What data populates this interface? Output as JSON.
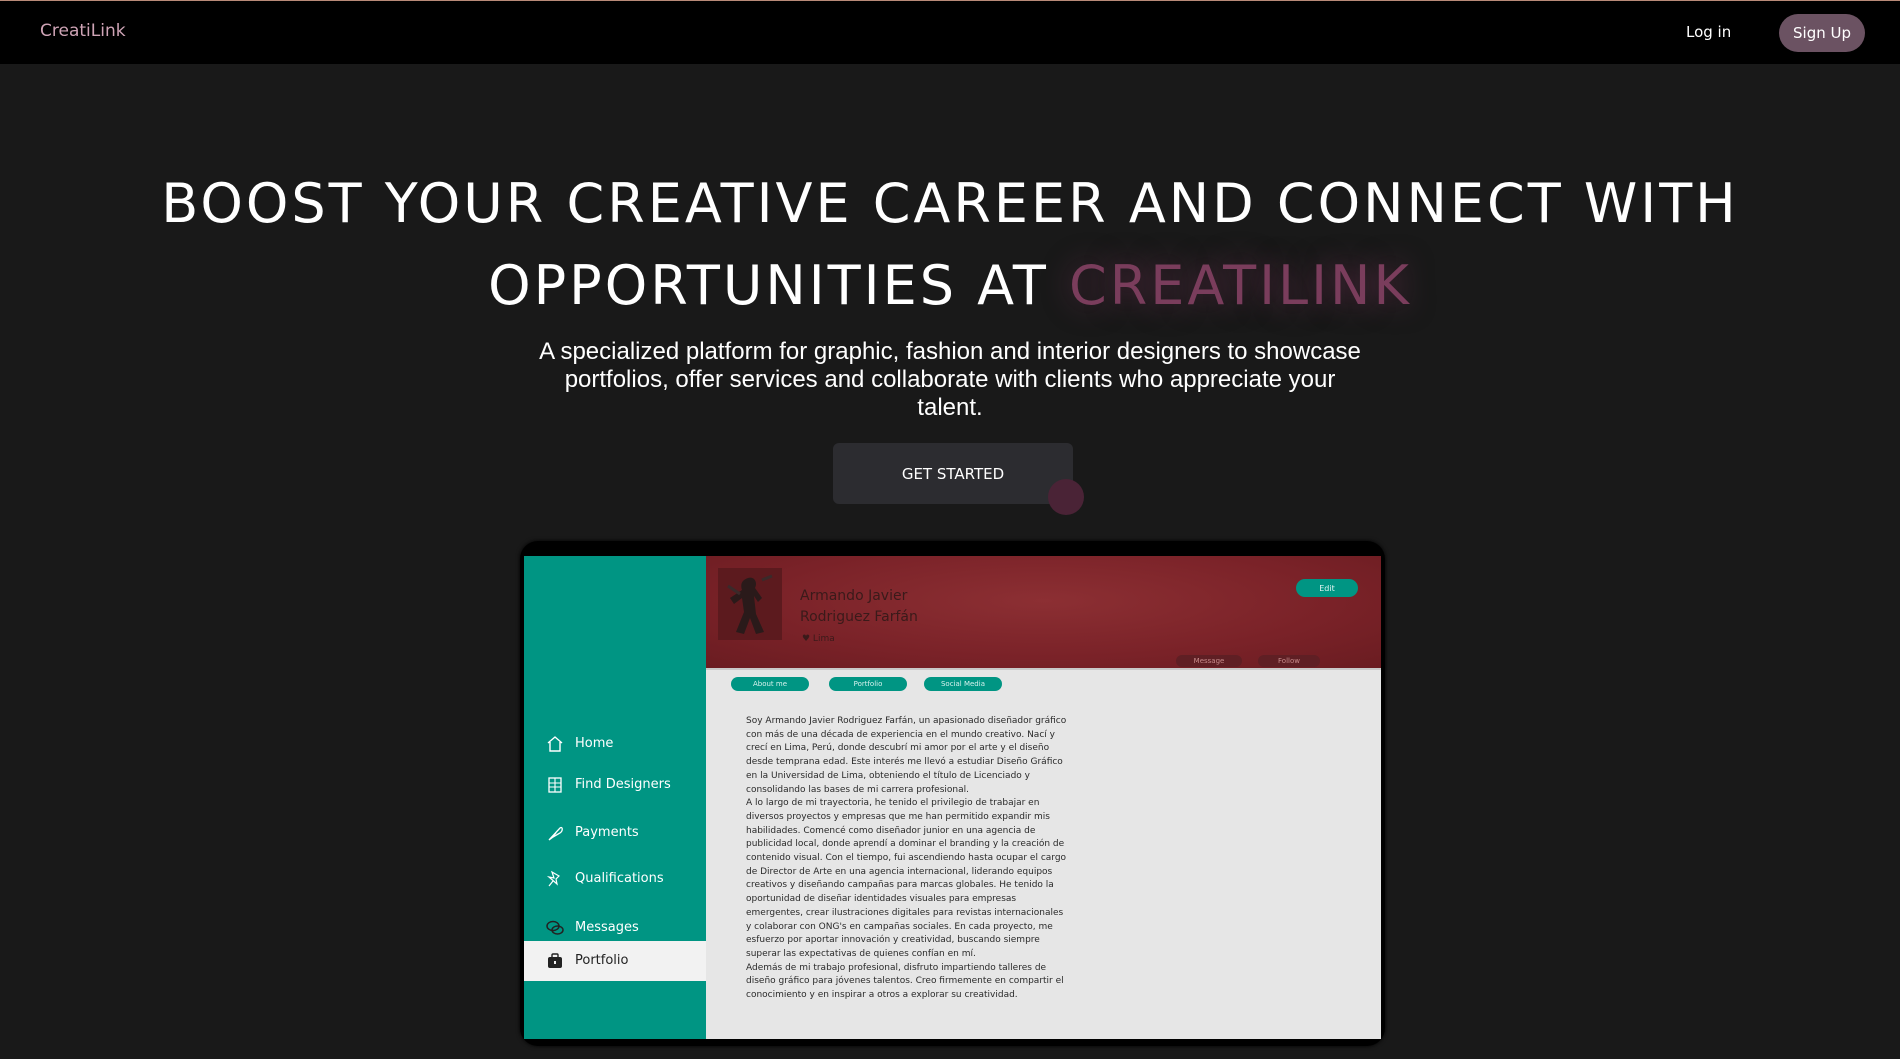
{
  "nav": {
    "brand": "CreatiLink",
    "login": "Log in",
    "signup": "Sign Up"
  },
  "hero": {
    "title_line1": "BOOST YOUR CREATIVE CAREER AND CONNECT WITH",
    "title_line2_prefix": "OPPORTUNITIES AT",
    "title_accent": "CREATILINK",
    "subtitle": "A specialized platform for graphic, fashion and interior designers to showcase portfolios, offer services and collaborate with clients who appreciate your talent.",
    "cta": "GET STARTED"
  },
  "mockup": {
    "sidebar": [
      {
        "label": "Home",
        "icon": "home-icon"
      },
      {
        "label": "Find Designers",
        "icon": "building-icon"
      },
      {
        "label": "Payments",
        "icon": "feather-icon"
      },
      {
        "label": "Qualifications",
        "icon": "pin-icon"
      },
      {
        "label": "Messages",
        "icon": "chat-icon"
      },
      {
        "label": "Portfolio",
        "icon": "briefcase-icon",
        "active": true
      }
    ],
    "profile": {
      "name_line1": "Armando Javier",
      "name_line2": "Rodriguez Farfán",
      "location": "♥ Lima",
      "edit": "Edit",
      "message": "Message",
      "follow": "Follow"
    },
    "tabs": [
      "About me",
      "Portfolio",
      "Social Media"
    ],
    "about": [
      "Soy Armando Javier Rodriguez Farfán, un apasionado diseñador gráfico con más de una década de experiencia en el mundo creativo. Nací y crecí en Lima, Perú, donde descubrí mi amor por el arte y el diseño desde temprana edad. Este interés me llevó a estudiar Diseño Gráfico en la Universidad de Lima, obteniendo el título de Licenciado y consolidando las bases de mi carrera profesional.",
      "A lo largo de mi trayectoria, he tenido el privilegio de trabajar en diversos proyectos y empresas que me han permitido expandir mis habilidades. Comencé como diseñador junior en una agencia de publicidad local, donde aprendí a dominar el branding y la creación de contenido visual. Con el tiempo, fui ascendiendo hasta ocupar el cargo de Director de Arte en una agencia internacional, liderando equipos creativos y diseñando campañas para marcas globales. He tenido la oportunidad de diseñar identidades visuales para empresas emergentes, crear ilustraciones digitales para revistas internacionales y colaborar con ONG's en campañas sociales. En cada proyecto, me esfuerzo por aportar innovación y creatividad, buscando siempre superar las expectativas de quienes confían en mí.",
      "Además de mi trabajo profesional, disfruto impartiendo talleres de diseño gráfico para jóvenes talentos. Creo firmemente en compartir el conocimiento y en inspirar a otros a explorar su creatividad."
    ]
  },
  "colors": {
    "accent": "#7a3d5c",
    "teal": "#009583",
    "header_red": "#7a2228",
    "background": "#191919"
  }
}
